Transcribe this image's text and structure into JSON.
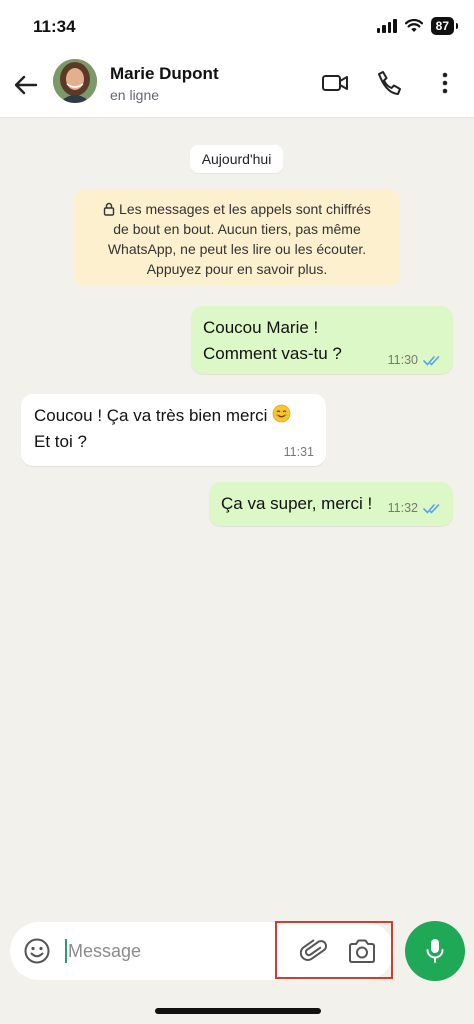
{
  "status_bar": {
    "time": "11:34",
    "battery": "87"
  },
  "header": {
    "contact_name": "Marie Dupont",
    "contact_status": "en ligne",
    "icons": [
      "back-arrow-icon",
      "video-call-icon",
      "phone-icon",
      "more-vertical-icon"
    ]
  },
  "chat": {
    "date_chip": "Aujourd'hui",
    "encryption_notice": [
      "Les messages et les appels sont chiffrés",
      "de bout en bout. Aucun tiers, pas même",
      "WhatsApp, ne peut les lire ou les écouter.",
      "Appuyez pour en savoir plus."
    ],
    "messages": [
      {
        "direction": "out",
        "lines": [
          "Coucou Marie !",
          "Comment vas-tu ?"
        ],
        "time": "11:30",
        "status": "read"
      },
      {
        "direction": "in",
        "lines": [
          "Coucou ! Ça va très bien merci",
          "Et toi ?"
        ],
        "emoji": "smiling-face-icon",
        "time": "11:31"
      },
      {
        "direction": "out",
        "lines": [
          "Ça va super, merci !"
        ],
        "time": "11:32",
        "status": "read"
      }
    ]
  },
  "input_bar": {
    "placeholder": "Message",
    "icons": [
      "emoji-icon",
      "attach-paperclip-icon",
      "camera-icon",
      "microphone-icon"
    ]
  },
  "colors": {
    "outgoing_bubble": "#dcf8c6",
    "incoming_bubble": "#ffffff",
    "notice_bg": "#fdf0cf",
    "read_ticks": "#53a6e6",
    "mic_button": "#1fa855",
    "highlight_box": "#d93a2b"
  }
}
